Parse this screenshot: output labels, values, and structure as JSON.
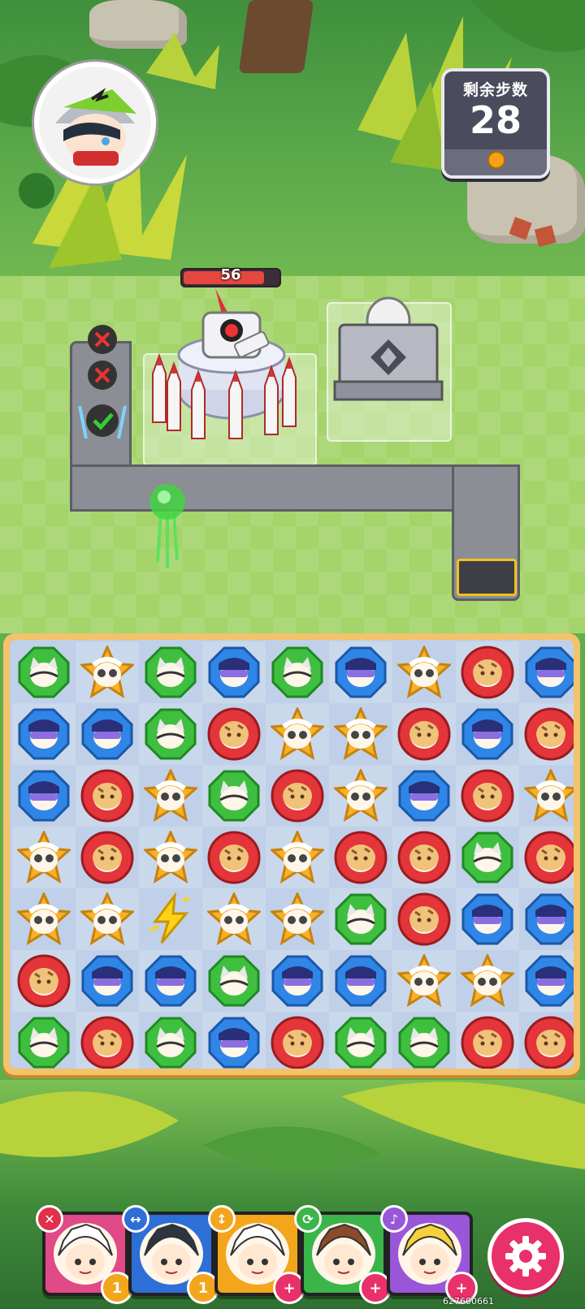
{
  "hud": {
    "moves_label": "剩余步数",
    "moves_value": "28"
  },
  "boss": {
    "hp": "56",
    "hp_fraction": 0.85
  },
  "board": {
    "legend": {
      "G": {
        "shape": "octagon",
        "color": "#3fbf3f",
        "ring": "#1e8a22",
        "icon": "cat-face-icon"
      },
      "Y": {
        "shape": "star",
        "color": "#f6b12a",
        "ring": "#c7820d",
        "icon": "sunglasses-face-icon"
      },
      "B": {
        "shape": "octagon",
        "color": "#2f86e6",
        "ring": "#1a58a8",
        "icon": "goggles-face-icon"
      },
      "R": {
        "shape": "circle",
        "color": "#e3353a",
        "ring": "#9c1b1f",
        "icon": "bread-face-icon"
      },
      "L": {
        "shape": "bolt",
        "color": "#ffd21a",
        "ring": "#c99600",
        "icon": "lightning-bolt-icon"
      }
    },
    "rows": [
      [
        "G",
        "Y",
        "G",
        "B",
        "G",
        "B",
        "Y",
        "R",
        "B"
      ],
      [
        "B",
        "B",
        "G",
        "R",
        "Y",
        "Y",
        "R",
        "B",
        "R"
      ],
      [
        "B",
        "R",
        "Y",
        "G",
        "R",
        "Y",
        "B",
        "R",
        "Y"
      ],
      [
        "Y",
        "R",
        "Y",
        "R",
        "Y",
        "R",
        "R",
        "G",
        "R"
      ],
      [
        "Y",
        "Y",
        "L",
        "Y",
        "Y",
        "G",
        "R",
        "B",
        "B"
      ],
      [
        "R",
        "B",
        "B",
        "G",
        "B",
        "B",
        "Y",
        "Y",
        "B"
      ],
      [
        "G",
        "R",
        "G",
        "B",
        "R",
        "G",
        "G",
        "R",
        "R"
      ]
    ]
  },
  "team": [
    {
      "frame": "#e04a86",
      "tag_color": "#e0304a",
      "tag_icon": "✕",
      "badge": "1",
      "badge_color": "#f3a51c",
      "hair": "#ffffff"
    },
    {
      "frame": "#2d6fd6",
      "tag_color": "#2d6fd6",
      "tag_icon": "↔",
      "badge": "1",
      "badge_color": "#f3a51c",
      "hair": "#2c3540"
    },
    {
      "frame": "#f3a51c",
      "tag_color": "#f3a51c",
      "tag_icon": "↕",
      "badge": "+",
      "badge_color": "#e8306a",
      "hair": "#ffffff"
    },
    {
      "frame": "#3bb54a",
      "tag_color": "#3bb54a",
      "tag_icon": "⟳",
      "badge": "+",
      "badge_color": "#e8306a",
      "hair": "#8b4a2a"
    },
    {
      "frame": "#9a56d8",
      "tag_color": "#9a56d8",
      "tag_icon": "♪",
      "badge": "+",
      "badge_color": "#e8306a",
      "hair": "#f6d23a"
    }
  ],
  "settings_icon": "gear-icon",
  "build_id": "627600661"
}
